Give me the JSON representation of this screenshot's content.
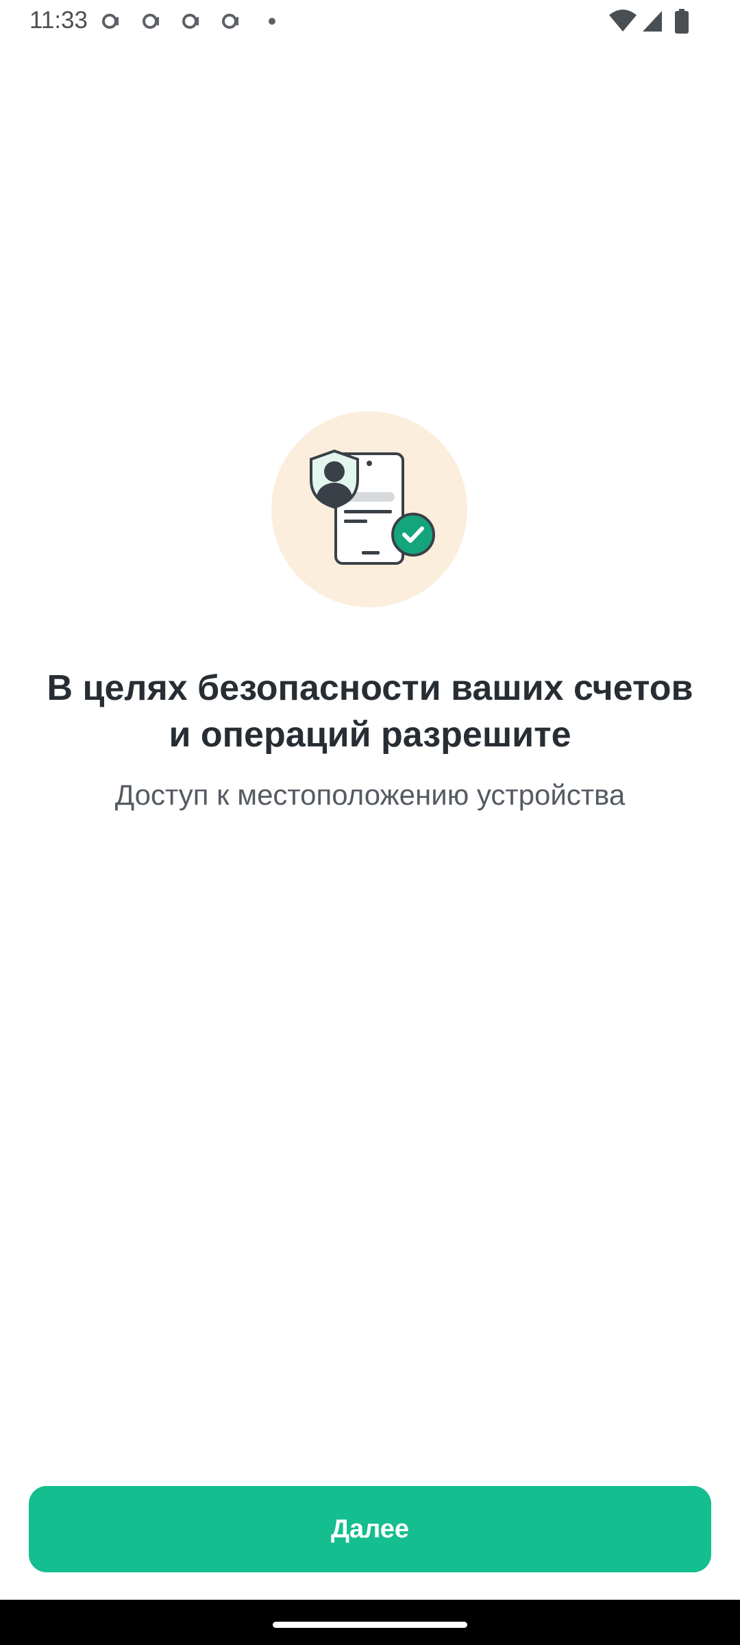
{
  "status_bar": {
    "time": "11:33",
    "notification_icons": [
      "notification-ring-icon",
      "notification-ring-icon",
      "notification-ring-icon",
      "notification-ring-icon"
    ],
    "system_icons": [
      "wifi-icon",
      "signal-icon",
      "battery-icon"
    ]
  },
  "illustration": {
    "icon": "secure-document-check-icon",
    "circle_color": "#fbeedc",
    "check_color": "#14a57c"
  },
  "content": {
    "title": "В целях безопасности ваших счетов\nи операций разрешите",
    "subtitle": "Доступ к местоположению устройства"
  },
  "actions": {
    "next_label": "Далее",
    "accent_color": "#14be8f"
  }
}
